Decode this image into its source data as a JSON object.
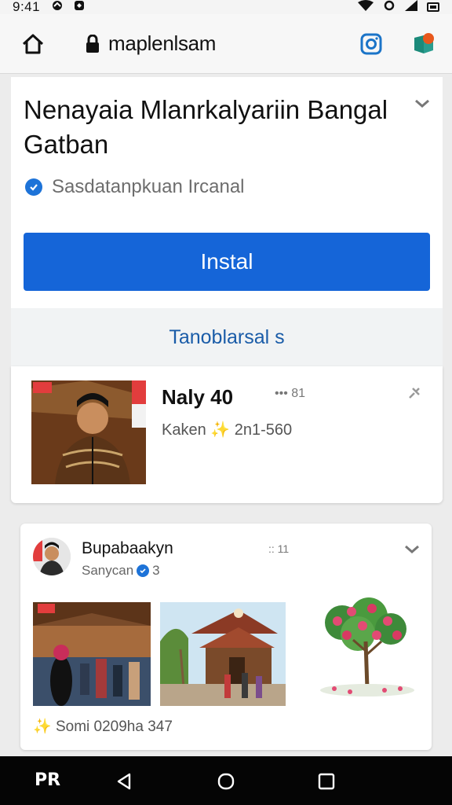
{
  "status_bar": {
    "time": "9:41"
  },
  "browser": {
    "url": "maplenlsam",
    "icons": [
      "home-icon",
      "lock-icon",
      "instagram-icon",
      "extension-icon"
    ]
  },
  "install_card": {
    "title": "Nenayaia Mlanrkalyariin Bangal Gatban",
    "verified_text": "Sasdatanpkuan Ircanal",
    "install_label": "Instal",
    "more_label": "Tanoblarsal s"
  },
  "profile": {
    "name": "Naly 40",
    "meta": "••• 81",
    "sub_prefix": "Kaken",
    "sub_spark": "✨",
    "sub_value": "2n1-560"
  },
  "post": {
    "author": "Bupabaakyn",
    "meta": ":: 11",
    "sub_left": "Sanycan",
    "sub_right": "3",
    "footer_spark": "✨",
    "footer_text": "Somi 0209ha 347"
  },
  "nav": {
    "logo": "PR"
  },
  "colors": {
    "accent": "#1565d8",
    "link": "#1a5ca8",
    "verified": "#1d73d8",
    "spark": "#e0a21c"
  }
}
